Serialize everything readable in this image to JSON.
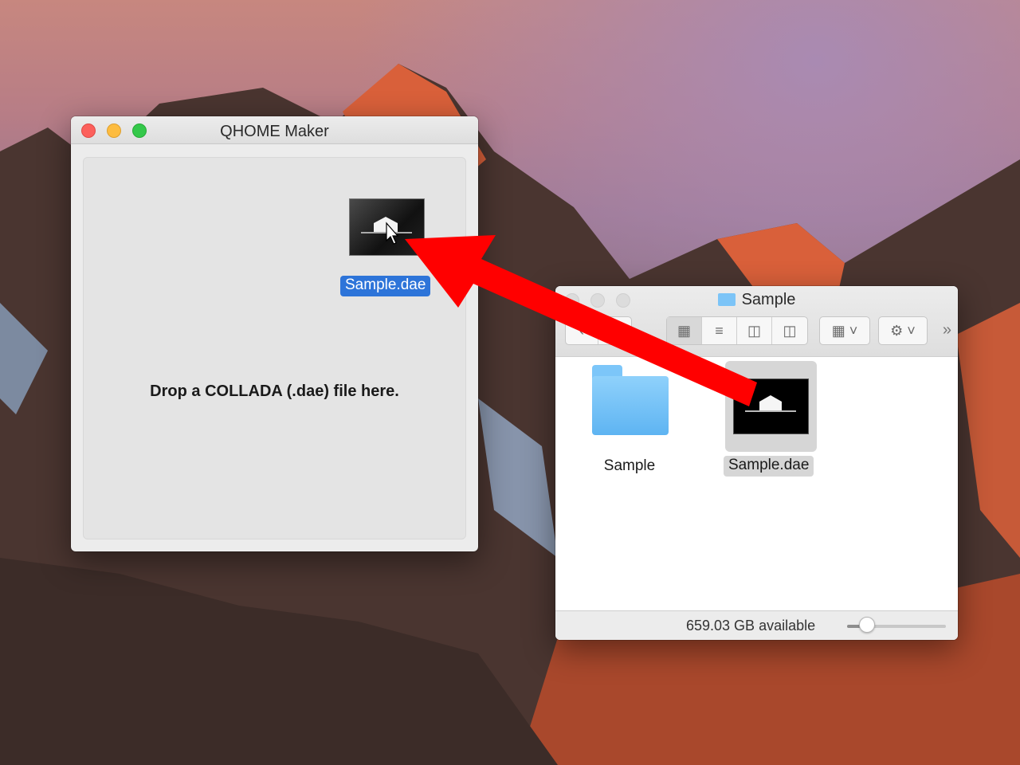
{
  "qhome_window": {
    "title": "QHOME Maker",
    "drop_prompt": "Drop a COLLADA (.dae) file here.",
    "dragged_file": "Sample.dae"
  },
  "finder_window": {
    "title": "Sample",
    "items": [
      {
        "name": "Sample",
        "kind": "folder"
      },
      {
        "name": "Sample.dae",
        "kind": "file"
      }
    ],
    "status": "659.03 GB available",
    "icon_size": 0.2
  },
  "annotation": {
    "color": "#ff0000"
  }
}
